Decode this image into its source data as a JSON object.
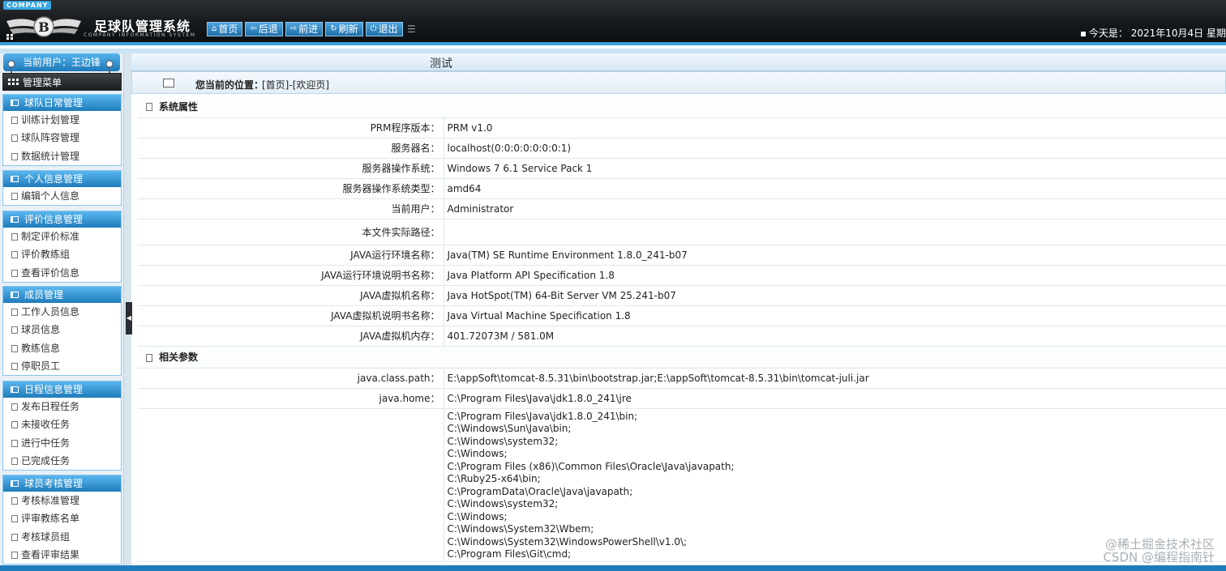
{
  "header": {
    "company": "COMPANY",
    "title": "足球队管理系统",
    "subtitle": "COMPANY INFORMATION SYSTEM",
    "nav": [
      {
        "icon": "home-icon",
        "glyph": "⌂",
        "label": "首页"
      },
      {
        "icon": "back-icon",
        "glyph": "⇦",
        "label": "后退"
      },
      {
        "icon": "forward-icon",
        "glyph": "⇨",
        "label": "前进"
      },
      {
        "icon": "refresh-icon",
        "glyph": "↻",
        "label": "刷新"
      },
      {
        "icon": "power-icon",
        "glyph": "⏻",
        "label": "退出"
      }
    ],
    "date": "今天是： 2021年10月4日 星期"
  },
  "sidebar": {
    "current_user": "当前用户：王边锋",
    "menu_title": "管理菜单",
    "sections": [
      {
        "title": "球队日常管理",
        "items": [
          "训练计划管理",
          "球队阵容管理",
          "数据统计管理"
        ]
      },
      {
        "title": "个人信息管理",
        "items": [
          "编辑个人信息"
        ]
      },
      {
        "title": "评价信息管理",
        "items": [
          "制定评价标准",
          "评价教练组",
          "查看评价信息"
        ]
      },
      {
        "title": "成员管理",
        "items": [
          "工作人员信息",
          "球员信息",
          "教练信息",
          "停职员工"
        ]
      },
      {
        "title": "日程信息管理",
        "items": [
          "发布日程任务",
          "未接收任务",
          "进行中任务",
          "已完成任务"
        ]
      },
      {
        "title": "球员考核管理",
        "items": [
          "考核标准管理",
          "评审教练名单",
          "考核球员组",
          "查看评审结果"
        ]
      }
    ]
  },
  "main": {
    "title": "测试",
    "crumb_label": "您当前的位置：",
    "crumb": "[首页]-[欢迎页]",
    "system": {
      "title": "系统属性",
      "rows": [
        {
          "k": "PRM程序版本：",
          "v": "PRM v1.0"
        },
        {
          "k": "服务器名：",
          "v": "localhost(0:0:0:0:0:0:0:1)"
        },
        {
          "k": "服务器操作系统：",
          "v": "Windows 7 6.1 Service Pack 1"
        },
        {
          "k": "服务器操作系统类型：",
          "v": "amd64"
        },
        {
          "k": "当前用户：",
          "v": "Administrator"
        },
        {
          "k": "本文件实际路径：",
          "v": ""
        },
        {
          "k": "JAVA运行环境名称：",
          "v": "Java(TM) SE Runtime Environment 1.8.0_241-b07"
        },
        {
          "k": "JAVA运行环境说明书名称：",
          "v": "Java Platform API Specification 1.8"
        },
        {
          "k": "JAVA虚拟机名称：",
          "v": "Java HotSpot(TM) 64-Bit Server VM 25.241-b07"
        },
        {
          "k": "JAVA虚拟机说明书名称：",
          "v": "Java Virtual Machine Specification 1.8"
        },
        {
          "k": "JAVA虚拟机内存：",
          "v": "401.72073M /  581.0M"
        }
      ]
    },
    "params": {
      "title": "相关参数",
      "rows": [
        {
          "k": "java.class.path：",
          "v": "E:\\appSoft\\tomcat-8.5.31\\bin\\bootstrap.jar;E:\\appSoft\\tomcat-8.5.31\\bin\\tomcat-juli.jar"
        },
        {
          "k": "java.home：",
          "v": "C:\\Program Files\\Java\\jdk1.8.0_241\\jre"
        }
      ],
      "library_path": [
        "C:\\Program Files\\Java\\jdk1.8.0_241\\bin;",
        "C:\\Windows\\Sun\\Java\\bin;",
        "C:\\Windows\\system32;",
        "C:\\Windows;",
        "C:\\Program Files (x86)\\Common Files\\Oracle\\Java\\javapath;",
        "C:\\Ruby25-x64\\bin;",
        "C:\\ProgramData\\Oracle\\Java\\javapath;",
        "C:\\Windows\\system32;",
        "C:\\Windows;",
        "C:\\Windows\\System32\\Wbem;",
        "C:\\Windows\\System32\\WindowsPowerShell\\v1.0\\;",
        "C:\\Program Files\\Git\\cmd;"
      ]
    }
  },
  "watermark": {
    "line1": "@稀土掘金技术社区",
    "line2": "CSDN @编程指南针"
  }
}
